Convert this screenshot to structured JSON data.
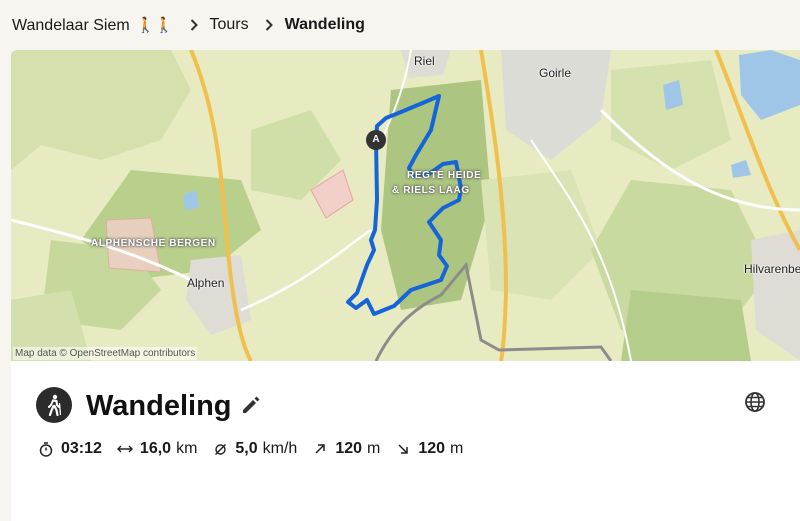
{
  "breadcrumb": {
    "user": "Wandelaar Siem",
    "user_emoji": "🚶🚶",
    "section": "Tours",
    "current": "Wandeling"
  },
  "map": {
    "attribution": "Map data © OpenStreetMap contributors",
    "labels": {
      "riel": "Riel",
      "goirle": "Goirle",
      "regte_heide": "REGTE HEIDE",
      "riels_laag": "& RIELS LAAG",
      "alphensche_bergen": "ALPHENSCHE BERGEN",
      "alphen": "Alphen",
      "hilvarenbeek": "Hilvarenbe"
    },
    "start_marker": "A",
    "route_color": "#1565d8"
  },
  "tour": {
    "title": "Wandeling",
    "activity_icon": "hiking-icon",
    "stats": {
      "duration": "03:12",
      "distance": "16,0",
      "distance_unit": "km",
      "speed": "5,0",
      "speed_unit": "km/h",
      "ascent": "120",
      "ascent_unit": "m",
      "descent": "120",
      "descent_unit": "m"
    }
  }
}
